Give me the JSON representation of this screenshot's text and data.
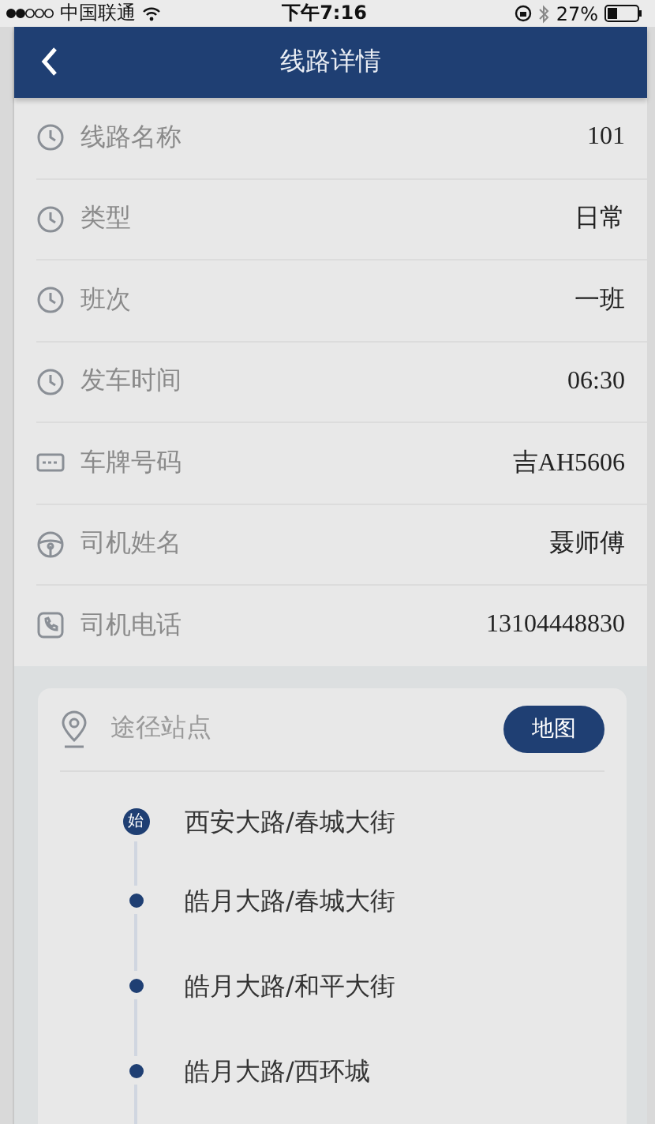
{
  "status_bar": {
    "carrier": "中国联通",
    "time": "下午7:16",
    "battery": "27%"
  },
  "nav": {
    "title": "线路详情"
  },
  "details": [
    {
      "kind": "time",
      "label": "线路名称",
      "value": "101"
    },
    {
      "kind": "time",
      "label": "类型",
      "value": "日常"
    },
    {
      "kind": "time",
      "label": "班次",
      "value": "一班"
    },
    {
      "kind": "time",
      "label": "发车时间",
      "value": "06:30"
    },
    {
      "kind": "plate",
      "label": "车牌号码",
      "value": "吉AH5606"
    },
    {
      "kind": "driver",
      "label": "司机姓名",
      "value": "聂师傅"
    },
    {
      "kind": "phone",
      "label": "司机电话",
      "value": "13104448830"
    }
  ],
  "stops_card": {
    "title": "途径站点",
    "map_button": "地图",
    "stops": [
      {
        "kind": "start",
        "badge": "始",
        "name": "西安大路/春城大街"
      },
      {
        "kind": "normal",
        "name": "皓月大路/春城大街"
      },
      {
        "kind": "normal",
        "name": "皓月大路/和平大街"
      },
      {
        "kind": "normal",
        "name": "皓月大路/西环城"
      }
    ]
  }
}
